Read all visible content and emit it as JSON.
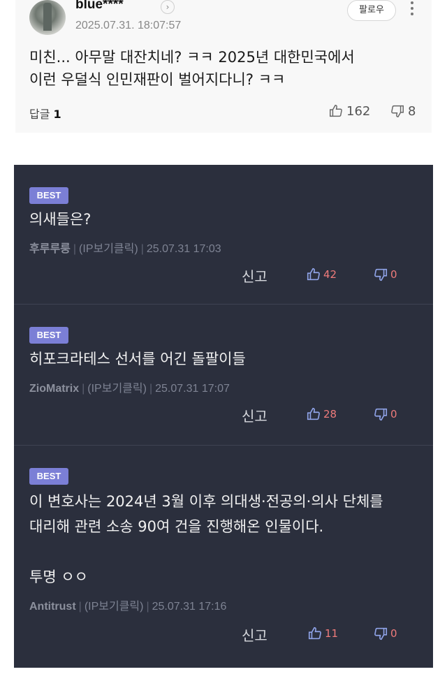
{
  "top_comment": {
    "username": "blue****",
    "timestamp": "2025.07.31. 18:07:57",
    "follow_label": "팔로우",
    "chevron_glyph": "›",
    "text_line1": "미친... 아무말 대잔치네? ㅋㅋ 2025년 대한민국에서",
    "text_line2": "이런 우덜식 인민재판이 벌어지다니? ㅋㅋ",
    "reply_label": "답글",
    "reply_count": "1",
    "likes": "162",
    "dislikes": "8"
  },
  "comments": [
    {
      "badge": "BEST",
      "text_lines": [
        "의새들은?"
      ],
      "nickname": "후루루룽",
      "ip": "(IP보기클릭)",
      "date": "25.07.31 17:03",
      "report": "신고",
      "likes": "42",
      "dislikes": "0"
    },
    {
      "badge": "BEST",
      "text_lines": [
        "히포크라테스 선서를 어긴 돌팔이들"
      ],
      "nickname": "ZioMatrix",
      "ip": "(IP보기클릭)",
      "date": "25.07.31 17:07",
      "report": "신고",
      "likes": "28",
      "dislikes": "0"
    },
    {
      "badge": "BEST",
      "text_lines": [
        "이 변호사는 2024년 3월 이후 의대생·전공의·의사 단체를",
        "대리해 관련 소송 90여 건을 진행해온 인물이다.",
        "",
        "투명 ㅇㅇ"
      ],
      "nickname": "Antitrust",
      "ip": "(IP보기클릭)",
      "date": "25.07.31 17:16",
      "report": "신고",
      "likes": "11",
      "dislikes": "0"
    }
  ],
  "separator": "|",
  "colors": {
    "panel_bg": "#2b2f3d",
    "badge_bg": "#7b7fd6",
    "count_red": "#ef7b7b",
    "icon_blue": "#8fa3e8"
  },
  "icons": {
    "like": "thumbs-up-icon",
    "dislike": "thumbs-down-icon",
    "more": "more-vertical-icon"
  }
}
